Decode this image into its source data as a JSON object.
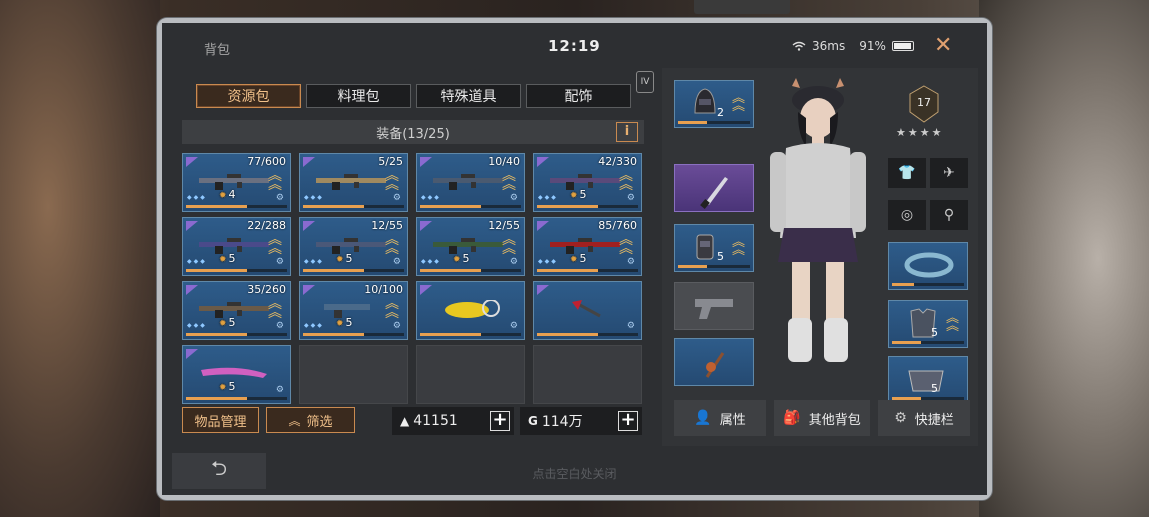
{
  "header": {
    "title": "背包",
    "time": "12:19",
    "ping": "36ms",
    "battery": "91%"
  },
  "tabs": [
    {
      "label": "资源包",
      "active": true
    },
    {
      "label": "料理包",
      "active": false
    },
    {
      "label": "特殊道具",
      "active": false
    },
    {
      "label": "配饰",
      "active": false
    }
  ],
  "tier_badge": "IV",
  "section": {
    "title": "装备(13/25)",
    "info": "i"
  },
  "inventory": [
    {
      "count": "77/600",
      "level": "4",
      "item": "rifle-icon",
      "color": "#6a7080"
    },
    {
      "count": "5/25",
      "level": "",
      "item": "sniper-icon",
      "color": "#a08a60"
    },
    {
      "count": "10/40",
      "level": "",
      "item": "rifle-icon",
      "color": "#4a5a70"
    },
    {
      "count": "42/330",
      "level": "5",
      "item": "rifle-icon",
      "color": "#5a4a7a"
    },
    {
      "count": "22/288",
      "level": "5",
      "item": "rifle-icon",
      "color": "#4a4a8a"
    },
    {
      "count": "12/55",
      "level": "5",
      "item": "rifle-icon",
      "color": "#4a5878"
    },
    {
      "count": "12/55",
      "level": "5",
      "item": "rifle-icon",
      "color": "#3a5a3a"
    },
    {
      "count": "85/760",
      "level": "5",
      "item": "rifle-icon",
      "color": "#a02020"
    },
    {
      "count": "35/260",
      "level": "5",
      "item": "rifle-icon",
      "color": "#6a5a48"
    },
    {
      "count": "10/100",
      "level": "5",
      "item": "pistol-icon",
      "color": "#4a6a8a"
    },
    {
      "count": "",
      "level": "",
      "item": "chainsaw-icon",
      "color": "#e8c820"
    },
    {
      "count": "",
      "level": "",
      "item": "pickaxe-icon",
      "color": "#c02030"
    },
    {
      "count": "",
      "level": "5",
      "item": "blade-icon",
      "color": "#d060c0"
    }
  ],
  "buttons": {
    "manage": "物品管理",
    "filter": "筛选"
  },
  "currency": {
    "primary": "41151",
    "secondary": "114万"
  },
  "hint": "点击空白处关闭",
  "character": {
    "level": "17",
    "stars": "★★★★",
    "slots": {
      "helmet_level": "2",
      "backpack_level": "5",
      "armor_level": "5",
      "right_lower_level": "5"
    }
  },
  "right_buttons": {
    "attributes": "属性",
    "other_bag": "其他背包",
    "shortcut": "快捷栏"
  },
  "colors": {
    "accent": "#c98a50",
    "slot_blue": "#2e5c8a",
    "slot_purple": "#6a4c98"
  }
}
